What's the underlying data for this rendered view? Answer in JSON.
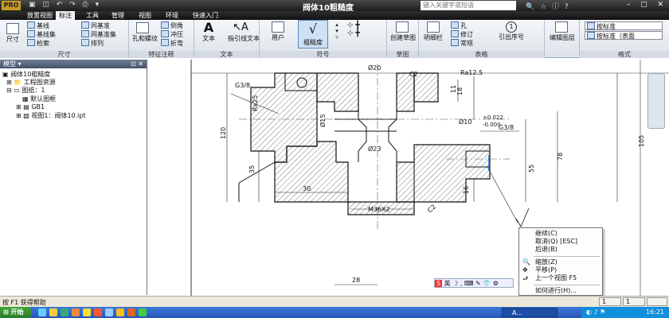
{
  "titlebar": {
    "app_logo": "PRO",
    "title": "阀体10粗糙度",
    "search_placeholder": "键入关键字或短语"
  },
  "menu": [
    "放置视图",
    "标注",
    "工具",
    "管理",
    "视图",
    "环境",
    "快速入门"
  ],
  "menu_active_index": 1,
  "ribbon": {
    "groups": [
      {
        "label": "尺寸",
        "items": [
          "尺寸",
          "基线",
          "基线集",
          "检索",
          "同基准",
          "同基准集",
          "排列"
        ]
      },
      {
        "label": "特征注释",
        "items": [
          "孔和螺纹",
          "倒角",
          "冲压",
          "折弯"
        ]
      },
      {
        "label": "文本",
        "items": [
          "文本",
          "指引线文本"
        ]
      },
      {
        "label": "符号",
        "items": [
          "用户",
          "粗糙度"
        ]
      },
      {
        "label": "草图",
        "items": [
          "创建草图"
        ]
      },
      {
        "label": "表格",
        "items": [
          "明细栏",
          "孔",
          "修订",
          "常规",
          "引出序号"
        ]
      },
      {
        "label": "",
        "items": [
          "编辑图层"
        ]
      },
      {
        "label": "格式",
        "items": [
          "按标准",
          "按标准（表面"
        ]
      }
    ]
  },
  "browser": {
    "header": "模型 ▾",
    "tree": [
      "阀体10粗糙度",
      "工程图资源",
      "图纸：1",
      "默认图框",
      "GB1",
      "视图1：阀体10.ipt"
    ]
  },
  "drawing": {
    "dims": [
      "G3/8",
      "Ra25",
      "Ø20",
      "C2",
      "Ra12.5",
      "11",
      "18",
      "Ø15",
      "Ø10",
      "+0.022",
      "-0.000",
      "G3/8",
      "120",
      "Ø23",
      "35",
      "30",
      "16",
      "55",
      "78",
      "105",
      "M36X2",
      "C2",
      "28"
    ]
  },
  "context_menu": {
    "items": [
      "继续(C)",
      "取消(Q) [ESC]",
      "后退(B)",
      "缩放(Z)",
      "平移(P)",
      "上一个视图    F5",
      "如何进行(H)..."
    ],
    "icons": [
      "",
      "",
      "",
      "zoom-icon",
      "pan-icon",
      "prev-view-icon",
      ""
    ]
  },
  "ime_bar": {
    "label": "英"
  },
  "status": {
    "help": "按 F1 获得帮助",
    "c1": "1",
    "c2": "1"
  },
  "taskbar": {
    "start": "开始",
    "app": "A...",
    "time": "16:21"
  }
}
